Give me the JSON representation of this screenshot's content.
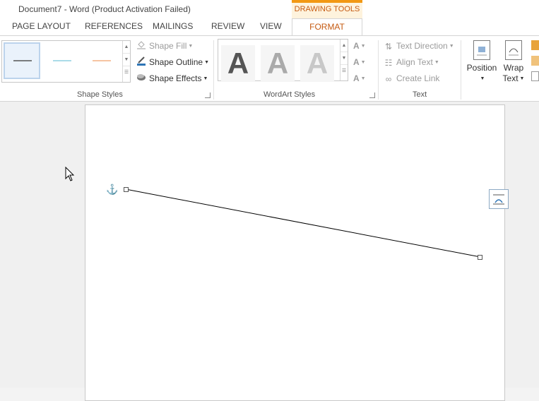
{
  "window": {
    "title": "Document7 - Word (Product Activation Failed)",
    "context_tab_group": "DRAWING TOOLS"
  },
  "tabs": [
    "PAGE LAYOUT",
    "REFERENCES",
    "MAILINGS",
    "REVIEW",
    "VIEW",
    "FORMAT"
  ],
  "active_tab": "FORMAT",
  "ribbon": {
    "shape_styles": {
      "label": "Shape Styles",
      "swatch_colors": [
        "#555555",
        "#8ecfe0",
        "#f4b183"
      ],
      "commands": {
        "shape_fill": "Shape Fill",
        "shape_outline": "Shape Outline",
        "shape_effects": "Shape Effects"
      }
    },
    "wordart_styles": {
      "label": "WordArt Styles",
      "letters": [
        "A",
        "A",
        "A"
      ]
    },
    "text": {
      "label": "Text",
      "commands": {
        "text_direction": "Text Direction",
        "align_text": "Align Text",
        "create_link": "Create Link"
      }
    },
    "arrange": {
      "position": "Position",
      "wrap_text_line1": "Wrap",
      "wrap_text_line2": "Text"
    }
  },
  "colors": {
    "accent": "#c55a11",
    "context_tab": "#f29813",
    "selection": "#bcd3ec"
  }
}
